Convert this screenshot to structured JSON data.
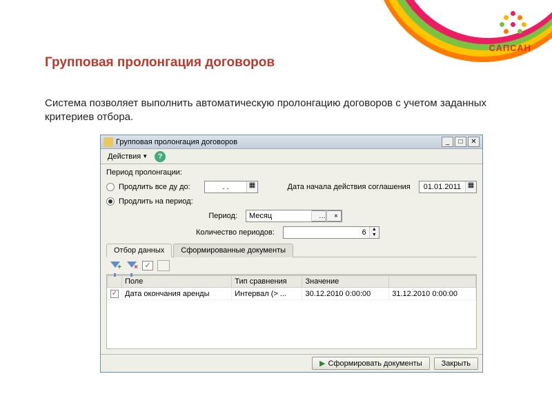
{
  "brand": {
    "name": "САПСАН"
  },
  "slide": {
    "title": "Групповая пролонгация договоров",
    "description": "Система позволяет выполнить автоматическую пролонгацию договоров с учетом заданных критериев отбора."
  },
  "window": {
    "title": "Групповая пролонгация договоров",
    "menu": {
      "actions": "Действия"
    },
    "section_label": "Период пролонгации:",
    "radio_until": "Продлить все ду до:",
    "radio_period": "Продлить на период:",
    "until_value": ". .",
    "agreement_start_label": "Дата начала действия соглашения",
    "agreement_start_value": "01.01.2011",
    "period_label": "Период:",
    "period_value": "Месяц",
    "count_label": "Количество периодов:",
    "count_value": "6",
    "tabs": {
      "filter": "Отбор данных",
      "docs": "Сформированные документы"
    },
    "grid": {
      "cols": {
        "field": "Поле",
        "cmp": "Тип сравнения",
        "val": "Значение",
        "val2": ""
      },
      "rows": [
        {
          "field": "Дата окончания аренды",
          "cmp": "Интервал (> ...",
          "v1": "30.12.2010 0:00:00",
          "v2": "31.12.2010 0:00:00"
        }
      ]
    },
    "buttons": {
      "generate": "Сформировать документы",
      "close": "Закрыть"
    }
  }
}
